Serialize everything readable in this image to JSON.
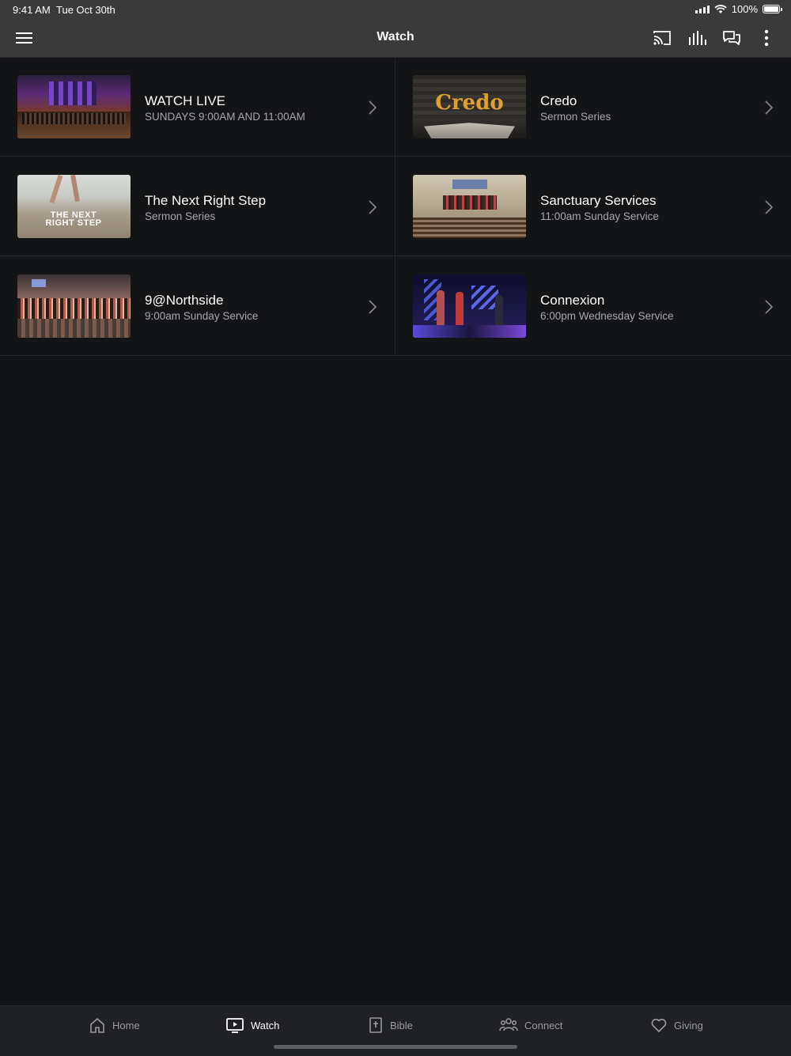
{
  "status": {
    "time": "9:41 AM",
    "date": "Tue Oct 30th",
    "battery": "100%"
  },
  "nav": {
    "title": "Watch"
  },
  "items": [
    {
      "title": "WATCH LIVE",
      "subtitle": "SUNDAYS 9:00AM AND 11:00AM"
    },
    {
      "title": "Credo",
      "subtitle": "Sermon Series",
      "thumb_text": "Credo"
    },
    {
      "title": "The Next Right Step",
      "subtitle": "Sermon Series",
      "thumb_text": "THE NEXT RIGHT STEP"
    },
    {
      "title": "Sanctuary Services",
      "subtitle": "11:00am Sunday Service"
    },
    {
      "title": "9@Northside",
      "subtitle": "9:00am Sunday Service"
    },
    {
      "title": "Connexion",
      "subtitle": "6:00pm Wednesday Service"
    }
  ],
  "tabs": [
    {
      "label": "Home",
      "icon": "home-icon"
    },
    {
      "label": "Watch",
      "icon": "tv-icon",
      "active": true
    },
    {
      "label": "Bible",
      "icon": "bible-icon"
    },
    {
      "label": "Connect",
      "icon": "people-icon"
    },
    {
      "label": "Giving",
      "icon": "heart-icon"
    }
  ]
}
